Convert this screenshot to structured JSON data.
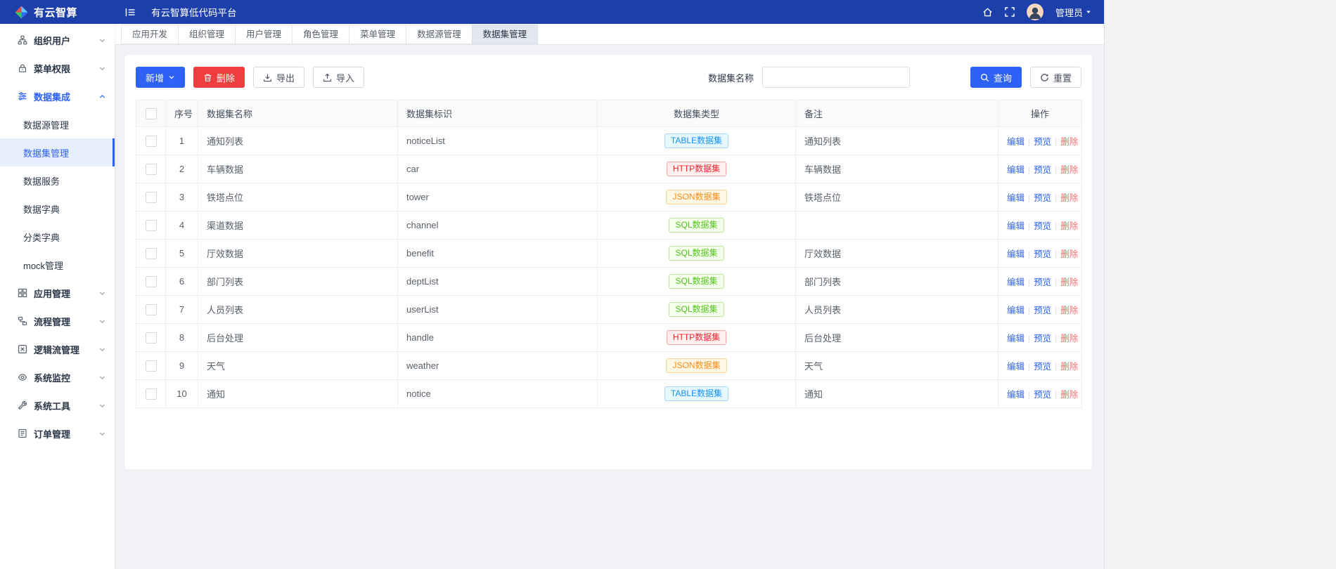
{
  "colors": {
    "header_bg": "#1c3faa",
    "accent": "#2e61f6",
    "danger": "#f03e3e",
    "tag_table": "#1890ff",
    "tag_http": "#f5222d",
    "tag_json": "#fa8c16",
    "tag_sql": "#52c41a"
  },
  "header": {
    "logo_text": "有云智算",
    "app_title": "有云智算低代码平台",
    "user_name": "管理员"
  },
  "sidebar": {
    "items": [
      {
        "id": "org-users",
        "label": "组织用户",
        "icon": "org-users-icon",
        "expanded": false
      },
      {
        "id": "menu-permissions",
        "label": "菜单权限",
        "icon": "menu-permissions-icon",
        "expanded": false
      },
      {
        "id": "data-integration",
        "label": "数据集成",
        "icon": "data-integration-icon",
        "expanded": true,
        "active": true,
        "children": [
          {
            "id": "datasource-mgmt",
            "label": "数据源管理",
            "active": false
          },
          {
            "id": "dataset-mgmt",
            "label": "数据集管理",
            "active": true
          },
          {
            "id": "data-service",
            "label": "数据服务",
            "active": false
          },
          {
            "id": "data-dictionary",
            "label": "数据字典",
            "active": false
          },
          {
            "id": "category-dictionary",
            "label": "分类字典",
            "active": false
          },
          {
            "id": "mock-mgmt",
            "label": "mock管理",
            "active": false
          }
        ]
      },
      {
        "id": "app-mgmt",
        "label": "应用管理",
        "icon": "app-mgmt-icon",
        "expanded": false
      },
      {
        "id": "process-mgmt",
        "label": "流程管理",
        "icon": "process-mgmt-icon",
        "expanded": false
      },
      {
        "id": "logic-flow-mgmt",
        "label": "逻辑流管理",
        "icon": "logic-flow-icon",
        "expanded": false
      },
      {
        "id": "system-monitor",
        "label": "系统监控",
        "icon": "system-monitor-icon",
        "expanded": false
      },
      {
        "id": "system-tools",
        "label": "系统工具",
        "icon": "system-tools-icon",
        "expanded": false
      },
      {
        "id": "order-mgmt",
        "label": "订单管理",
        "icon": "order-mgmt-icon",
        "expanded": false
      }
    ]
  },
  "tabs": {
    "active_index": 6,
    "items": [
      {
        "id": "app-dev",
        "label": "应用开发"
      },
      {
        "id": "org-mgmt",
        "label": "组织管理"
      },
      {
        "id": "user-mgmt",
        "label": "用户管理"
      },
      {
        "id": "role-mgmt",
        "label": "角色管理"
      },
      {
        "id": "menu-mgmt",
        "label": "菜单管理"
      },
      {
        "id": "datasource-mgmt",
        "label": "数据源管理"
      },
      {
        "id": "dataset-mgmt",
        "label": "数据集管理"
      }
    ]
  },
  "toolbar": {
    "add_label": "新增",
    "delete_label": "删除",
    "export_label": "导出",
    "import_label": "导入",
    "search_label": "数据集名称",
    "search_value": "",
    "query_label": "查询",
    "reset_label": "重置"
  },
  "table": {
    "columns": {
      "index": "序号",
      "name": "数据集名称",
      "code": "数据集标识",
      "type": "数据集类型",
      "remark": "备注",
      "actions": "操作"
    },
    "actions": [
      {
        "id": "edit",
        "label": "编辑",
        "danger": false
      },
      {
        "id": "preview",
        "label": "预览",
        "danger": false
      },
      {
        "id": "delete",
        "label": "删除",
        "danger": true
      }
    ],
    "rows": [
      {
        "index": 1,
        "name": "通知列表",
        "code": "noticeList",
        "type": "TABLE数据集",
        "remark": "通知列表"
      },
      {
        "index": 2,
        "name": "车辆数据",
        "code": "car",
        "type": "HTTP数据集",
        "remark": "车辆数据"
      },
      {
        "index": 3,
        "name": "铁塔点位",
        "code": "tower",
        "type": "JSON数据集",
        "remark": "铁塔点位"
      },
      {
        "index": 4,
        "name": "渠道数据",
        "code": "channel",
        "type": "SQL数据集",
        "remark": ""
      },
      {
        "index": 5,
        "name": "厅效数据",
        "code": "benefit",
        "type": "SQL数据集",
        "remark": "厅效数据"
      },
      {
        "index": 6,
        "name": "部门列表",
        "code": "deptList",
        "type": "SQL数据集",
        "remark": "部门列表"
      },
      {
        "index": 7,
        "name": "人员列表",
        "code": "userList",
        "type": "SQL数据集",
        "remark": "人员列表"
      },
      {
        "index": 8,
        "name": "后台处理",
        "code": "handle",
        "type": "HTTP数据集",
        "remark": "后台处理"
      },
      {
        "index": 9,
        "name": "天气",
        "code": "weather",
        "type": "JSON数据集",
        "remark": "天气"
      },
      {
        "index": 10,
        "name": "通知",
        "code": "notice",
        "type": "TABLE数据集",
        "remark": "通知"
      }
    ]
  }
}
